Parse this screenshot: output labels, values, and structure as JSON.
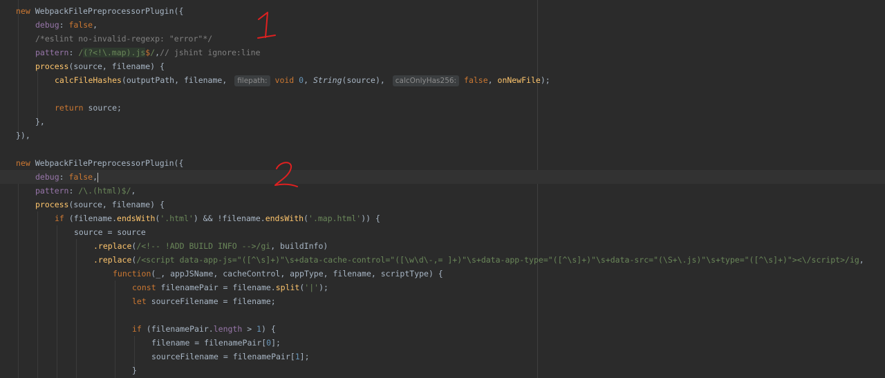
{
  "annotations": {
    "first": "1",
    "second": "2"
  },
  "code": {
    "l1_new": "new",
    "l1_class": "WebpackFilePreprocessorPlugin",
    "l1_open": "({",
    "l2_key": "debug",
    "l2_val": "false",
    "l3_comment": "/*eslint no-invalid-regexp: \"error\"*/",
    "l4_key": "pattern",
    "l4_open": "/",
    "l4_re1": "(?<!\\.map)",
    "l4_re2": ".js",
    "l4_dollar": "$",
    "l4_close": "/",
    "l4_comment": "// jshint ignore:line",
    "l5_fn": "process",
    "l5_args": "(source, filename) {",
    "l6_fn": "calcFileHashes",
    "l6_a": "(outputPath, filename, ",
    "l6_hint1": "filepath:",
    "l6_void": "void",
    "l6_zero": "0",
    "l6_comma1": ", ",
    "l6_string": "String",
    "l6_src": "(source), ",
    "l6_hint2": "calcOnlyHas256:",
    "l6_false": "false",
    "l6_comma2": ", ",
    "l6_cb": "onNewFile",
    "l6_end": ");",
    "l8_return": "return",
    "l8_rest": " source;",
    "l9_close": "},",
    "l10_close": "}),",
    "l12_new": "new",
    "l12_class": "WebpackFilePreprocessorPlugin",
    "l12_open": "({",
    "l13_key": "debug",
    "l13_val": "false",
    "l14_key": "pattern",
    "l14_re": "/\\.(html)$/",
    "l15_fn": "process",
    "l15_args": "(source, filename) {",
    "l16_if": "if",
    "l16_a": " (filename.",
    "l16_ends1": "endsWith",
    "l16_str1": "'.html'",
    "l16_mid": ") && !filename.",
    "l16_ends2": "endsWith",
    "l16_str2": "'.map.html'",
    "l16_end": ")) {",
    "l17_text": "source = source",
    "l18_replace": ".replace",
    "l18_re": "/<!-- !ADD BUILD INFO -->/gi",
    "l18_rest": ", buildInfo)",
    "l19_replace": ".replace",
    "l19_re": "/<script data-app-js=\"([^\\s]+)\"\\s+data-cache-control=\"([\\w\\d\\-,= ]+)\"\\s+data-app-type=\"([^\\s]+)\"\\s+data-src=\"(\\S+\\.js)\"\\s+type=\"([^\\s]+)\"><\\/script>/ig",
    "l20_function": "function",
    "l20_args": "(_, appJSName, cacheControl, appType, filename, scriptType) {",
    "l21_const": "const",
    "l21_a": " filenamePair = filename.",
    "l21_split": "split",
    "l21_str": "'|'",
    "l21_end": ");",
    "l22_let": "let",
    "l22_rest": " sourceFilename = filename;",
    "l24_if": "if",
    "l24_a": " (filenamePair.",
    "l24_len": "length",
    "l24_b": " > ",
    "l24_num": "1",
    "l24_end": ") {",
    "l25_text": "filename = filenamePair[",
    "l25_num": "0",
    "l25_end": "];",
    "l26_text": "sourceFilename = filenamePair[",
    "l26_num": "1",
    "l26_end": "];",
    "l27_text": "}"
  }
}
